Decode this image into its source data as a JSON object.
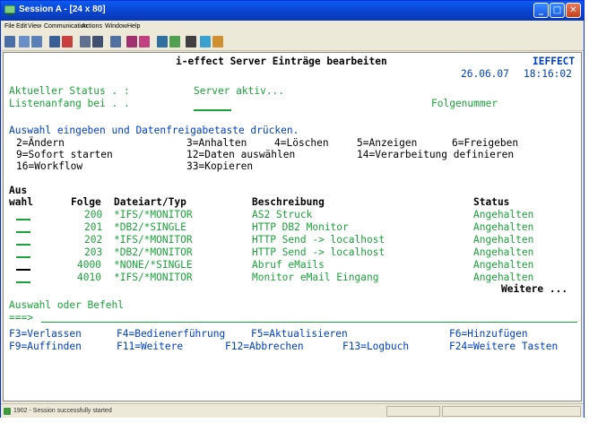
{
  "window": {
    "title": "Session A - [24 x 80]",
    "minimize": "_",
    "maximize": "□",
    "close": "✕"
  },
  "menu": [
    "File",
    "Edit",
    "View",
    "Communication",
    "Actions",
    "Window",
    "Help"
  ],
  "screen": {
    "title": "i-effect Server Einträge bearbeiten",
    "system": "IEFFECT",
    "date": "26.06.07",
    "time": "18:16:02",
    "status_label": "Aktueller Status . :",
    "status_value": "Server aktiv...",
    "list_start_label": "Listenanfang bei . .",
    "list_start_value": "",
    "list_start_hint": "Folgenummer",
    "instruction": "Auswahl eingeben und Datenfreigabetaste drücken.",
    "options": [
      [
        "2=Ändern",
        "3=Anhalten",
        "4=Löschen",
        "5=Anzeigen",
        "6=Freigeben"
      ],
      [
        "9=Sofort starten",
        "12=Daten auswählen",
        "14=Verarbeitung definieren"
      ],
      [
        "16=Workflow",
        "33=Kopieren"
      ]
    ],
    "col_headers": {
      "aus": "Aus",
      "wahl": "wahl",
      "folge": "Folge",
      "dateiart": "Dateiart/Typ",
      "beschreibung": "Beschreibung",
      "status": "Status"
    },
    "rows": [
      {
        "folge": "200",
        "dateiart": "*IFS/*MONITOR",
        "beschreibung": "AS2 Struck",
        "status": "Angehalten"
      },
      {
        "folge": "201",
        "dateiart": "*DB2/*SINGLE",
        "beschreibung": "HTTP DB2 Monitor",
        "status": "Angehalten"
      },
      {
        "folge": "202",
        "dateiart": "*IFS/*MONITOR",
        "beschreibung": "HTTP Send -> localhost",
        "status": "Angehalten"
      },
      {
        "folge": "203",
        "dateiart": "*DB2/*MONITOR",
        "beschreibung": "HTTP Send -> localhost",
        "status": "Angehalten"
      },
      {
        "folge": "4000",
        "dateiart": "*NONE/*SINGLE",
        "beschreibung": "Abruf eMails",
        "status": "Angehalten"
      },
      {
        "folge": "4010",
        "dateiart": "*IFS/*MONITOR",
        "beschreibung": "Monitor eMail Eingang",
        "status": "Angehalten"
      }
    ],
    "more": "Weitere ...",
    "command_label": "Auswahl oder Befehl",
    "command_prompt": "===>",
    "fkeys": [
      [
        "F3=Verlassen",
        "F4=Bedienerführung",
        "F5=Aktualisieren",
        "F6=Hinzufügen"
      ],
      [
        "F9=Auffinden",
        "F11=Weitere",
        "F12=Abbrechen",
        "F13=Logbuch",
        "F24=Weitere Tasten"
      ]
    ]
  },
  "statusbar": {
    "text": "1902 - Session successfully started"
  }
}
